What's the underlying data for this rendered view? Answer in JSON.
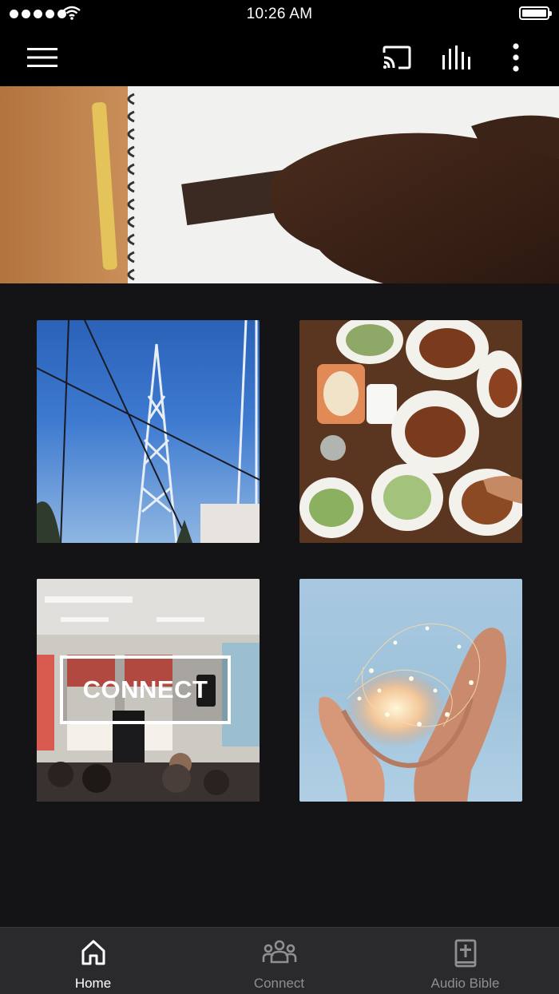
{
  "status_bar": {
    "time": "10:26 AM"
  },
  "toolbar": {
    "menu_icon": "hamburger-icon",
    "cast_icon": "cast-icon",
    "audio_icon": "equalizer-icon",
    "more_icon": "more-vertical-icon"
  },
  "grid": {
    "tiles": [
      {
        "image": "radio-tower-photo"
      },
      {
        "image": "dinner-table-photo"
      },
      {
        "image": "church-event-photo",
        "label": "CONNECT"
      },
      {
        "image": "hands-string-lights-photo"
      }
    ]
  },
  "tabbar": {
    "tabs": [
      {
        "label": "Home",
        "icon": "home-icon",
        "active": true
      },
      {
        "label": "Connect",
        "icon": "group-icon",
        "active": false
      },
      {
        "label": "Audio Bible",
        "icon": "bible-icon",
        "active": false
      }
    ],
    "active_color": "#ffffff",
    "inactive_color": "#8e8e93"
  }
}
